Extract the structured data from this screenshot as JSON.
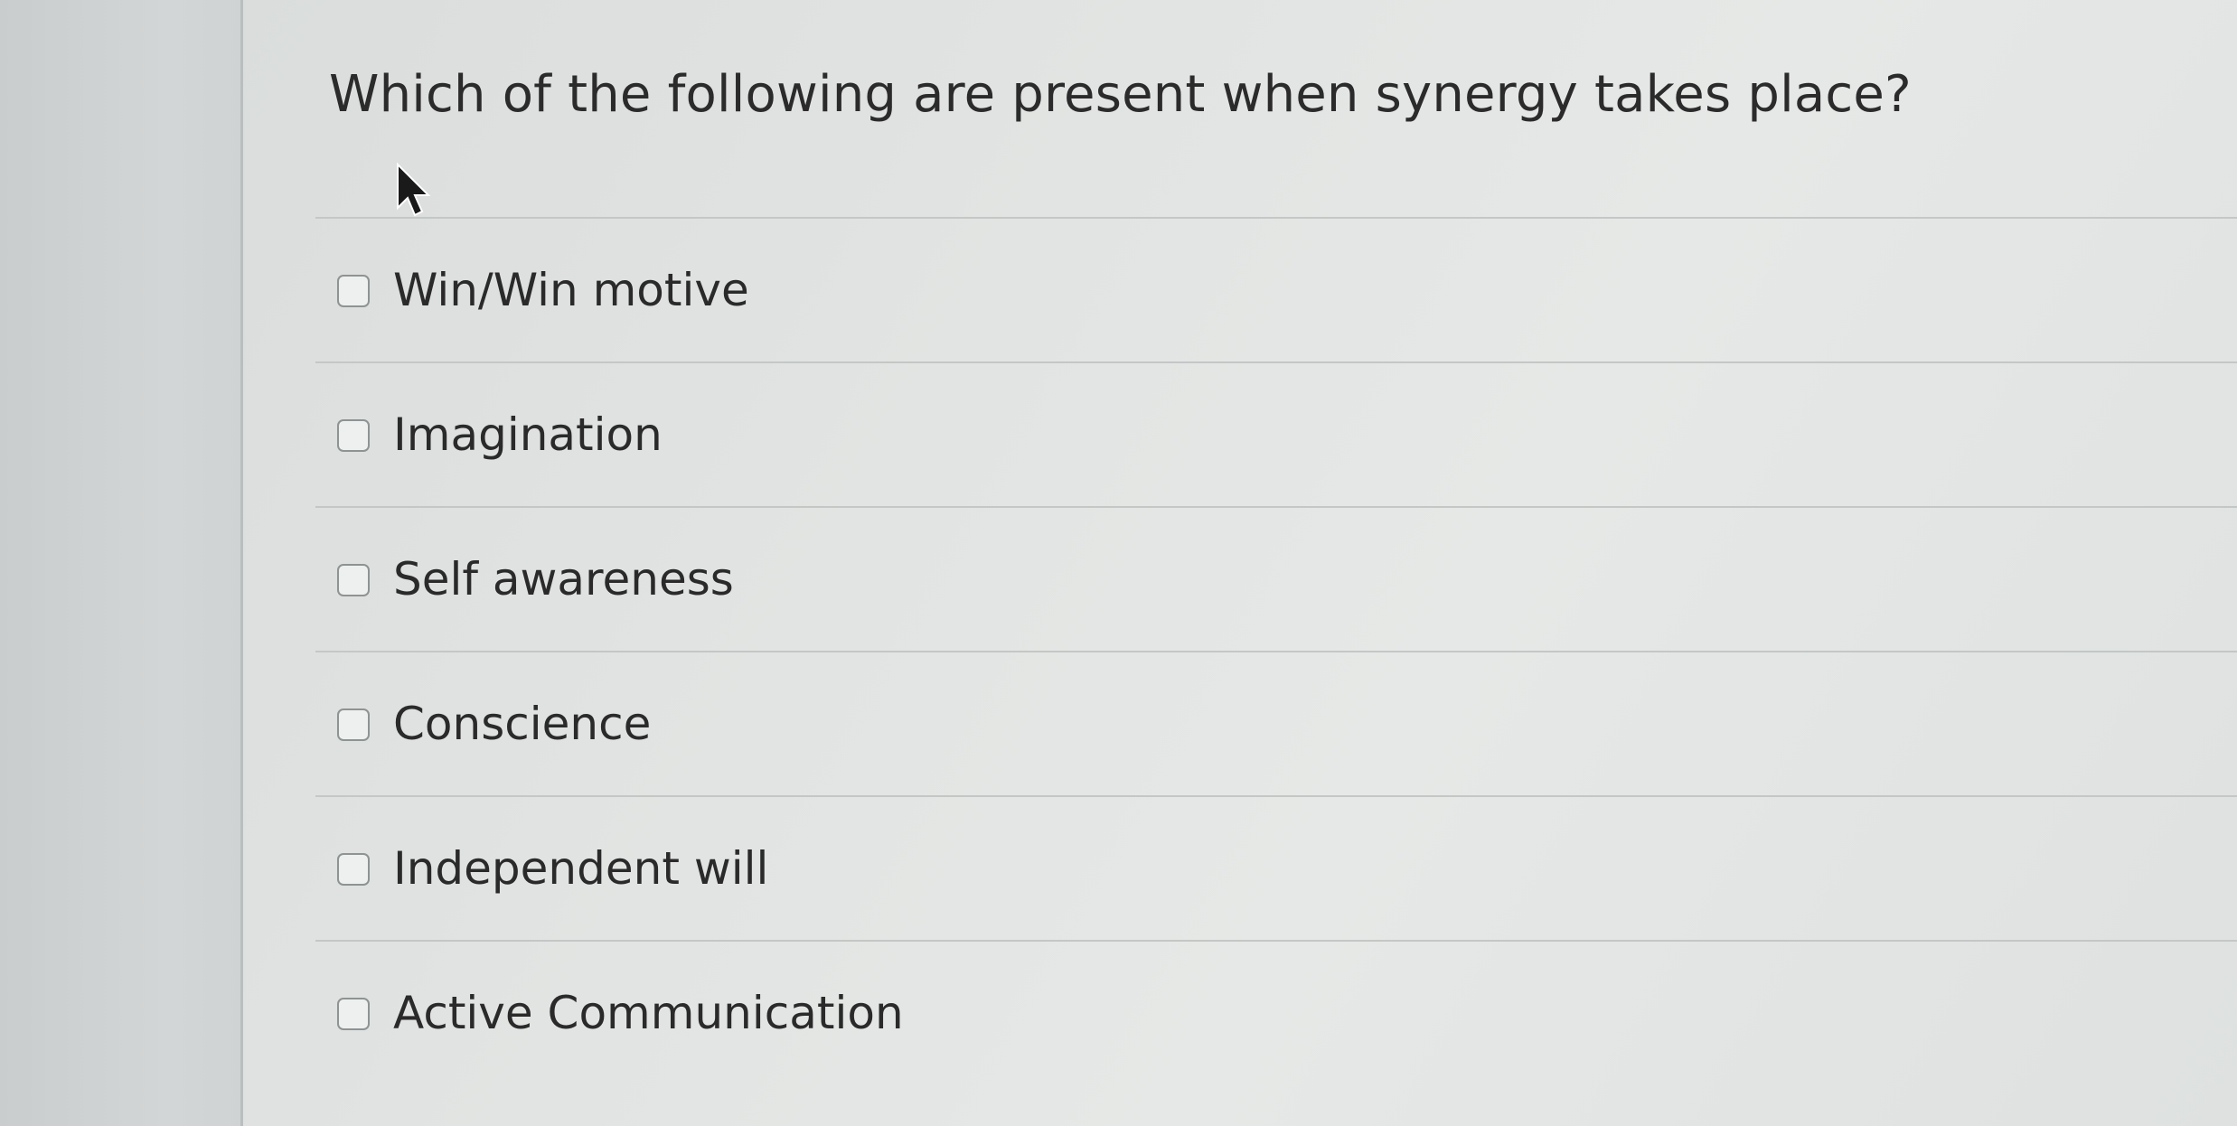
{
  "question": {
    "text": "Which of the following are present when synergy takes place?"
  },
  "options": [
    {
      "label": "Win/Win motive",
      "checked": false
    },
    {
      "label": "Imagination",
      "checked": false
    },
    {
      "label": "Self awareness",
      "checked": false
    },
    {
      "label": "Conscience",
      "checked": false
    },
    {
      "label": "Independent will",
      "checked": false
    },
    {
      "label": "Active Communication",
      "checked": false
    }
  ],
  "icons": {
    "cursor": "mouse-pointer-icon"
  },
  "colors": {
    "text": "#2b2b2b",
    "divider": "#c3c7c6",
    "checkbox_border": "#8e9393"
  }
}
